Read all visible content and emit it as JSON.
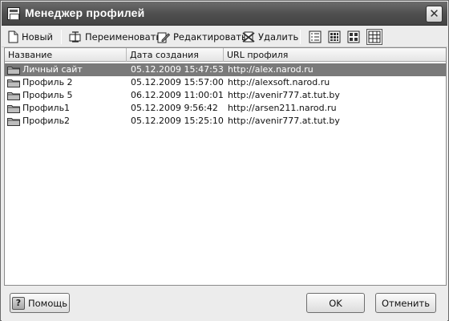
{
  "window": {
    "title": "Менеджер профилей",
    "close_glyph": "✕"
  },
  "toolbar": {
    "new_label": "Новый",
    "rename_label": "Переименовать",
    "edit_label": "Редактировать",
    "delete_label": "Удалить",
    "views": [
      "view-details",
      "view-large-icons",
      "view-tiles",
      "view-list"
    ],
    "active_view": "view-list"
  },
  "table": {
    "columns": [
      "Название",
      "Дата создания",
      "URL профиля"
    ],
    "rows": [
      {
        "name": "Личный сайт",
        "created": "05.12.2009 15:47:53",
        "url": "http://alex.narod.ru",
        "selected": true
      },
      {
        "name": "Профиль 2",
        "created": "05.12.2009 15:57:00",
        "url": "http://alexsoft.narod.ru",
        "selected": false
      },
      {
        "name": "Профиль 5",
        "created": "06.12.2009 11:00:01",
        "url": "http://avenir777.at.tut.by",
        "selected": false
      },
      {
        "name": "Профиль1",
        "created": "05.12.2009 9:56:42",
        "url": "http://arsen211.narod.ru",
        "selected": false
      },
      {
        "name": "Профиль2",
        "created": "05.12.2009 15:25:10",
        "url": "http://avenir777.at.tut.by",
        "selected": false
      }
    ]
  },
  "footer": {
    "help_label": "Помощь",
    "help_icon_glyph": "?",
    "ok_label": "OK",
    "cancel_label": "Отменить"
  },
  "colors": {
    "titlebar": "#4e4e4e",
    "selection": "#7a7a7a",
    "window_bg": "#ececec"
  }
}
